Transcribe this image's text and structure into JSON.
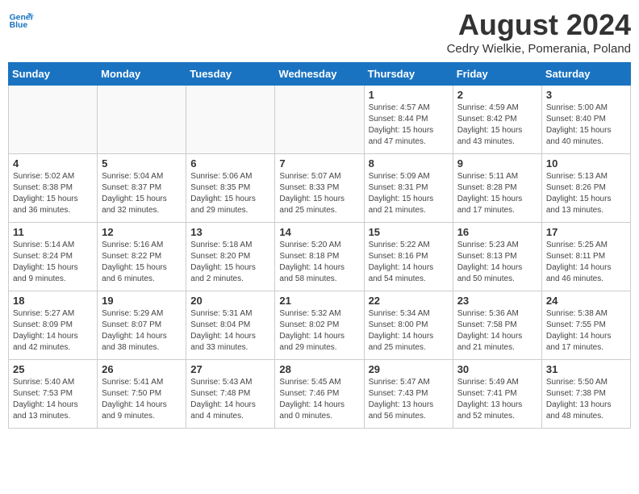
{
  "header": {
    "logo_line1": "General",
    "logo_line2": "Blue",
    "month_title": "August 2024",
    "location": "Cedry Wielkie, Pomerania, Poland"
  },
  "weekdays": [
    "Sunday",
    "Monday",
    "Tuesday",
    "Wednesday",
    "Thursday",
    "Friday",
    "Saturday"
  ],
  "weeks": [
    [
      {
        "day": "",
        "info": ""
      },
      {
        "day": "",
        "info": ""
      },
      {
        "day": "",
        "info": ""
      },
      {
        "day": "",
        "info": ""
      },
      {
        "day": "1",
        "info": "Sunrise: 4:57 AM\nSunset: 8:44 PM\nDaylight: 15 hours and 47 minutes."
      },
      {
        "day": "2",
        "info": "Sunrise: 4:59 AM\nSunset: 8:42 PM\nDaylight: 15 hours and 43 minutes."
      },
      {
        "day": "3",
        "info": "Sunrise: 5:00 AM\nSunset: 8:40 PM\nDaylight: 15 hours and 40 minutes."
      }
    ],
    [
      {
        "day": "4",
        "info": "Sunrise: 5:02 AM\nSunset: 8:38 PM\nDaylight: 15 hours and 36 minutes."
      },
      {
        "day": "5",
        "info": "Sunrise: 5:04 AM\nSunset: 8:37 PM\nDaylight: 15 hours and 32 minutes."
      },
      {
        "day": "6",
        "info": "Sunrise: 5:06 AM\nSunset: 8:35 PM\nDaylight: 15 hours and 29 minutes."
      },
      {
        "day": "7",
        "info": "Sunrise: 5:07 AM\nSunset: 8:33 PM\nDaylight: 15 hours and 25 minutes."
      },
      {
        "day": "8",
        "info": "Sunrise: 5:09 AM\nSunset: 8:31 PM\nDaylight: 15 hours and 21 minutes."
      },
      {
        "day": "9",
        "info": "Sunrise: 5:11 AM\nSunset: 8:28 PM\nDaylight: 15 hours and 17 minutes."
      },
      {
        "day": "10",
        "info": "Sunrise: 5:13 AM\nSunset: 8:26 PM\nDaylight: 15 hours and 13 minutes."
      }
    ],
    [
      {
        "day": "11",
        "info": "Sunrise: 5:14 AM\nSunset: 8:24 PM\nDaylight: 15 hours and 9 minutes."
      },
      {
        "day": "12",
        "info": "Sunrise: 5:16 AM\nSunset: 8:22 PM\nDaylight: 15 hours and 6 minutes."
      },
      {
        "day": "13",
        "info": "Sunrise: 5:18 AM\nSunset: 8:20 PM\nDaylight: 15 hours and 2 minutes."
      },
      {
        "day": "14",
        "info": "Sunrise: 5:20 AM\nSunset: 8:18 PM\nDaylight: 14 hours and 58 minutes."
      },
      {
        "day": "15",
        "info": "Sunrise: 5:22 AM\nSunset: 8:16 PM\nDaylight: 14 hours and 54 minutes."
      },
      {
        "day": "16",
        "info": "Sunrise: 5:23 AM\nSunset: 8:13 PM\nDaylight: 14 hours and 50 minutes."
      },
      {
        "day": "17",
        "info": "Sunrise: 5:25 AM\nSunset: 8:11 PM\nDaylight: 14 hours and 46 minutes."
      }
    ],
    [
      {
        "day": "18",
        "info": "Sunrise: 5:27 AM\nSunset: 8:09 PM\nDaylight: 14 hours and 42 minutes."
      },
      {
        "day": "19",
        "info": "Sunrise: 5:29 AM\nSunset: 8:07 PM\nDaylight: 14 hours and 38 minutes."
      },
      {
        "day": "20",
        "info": "Sunrise: 5:31 AM\nSunset: 8:04 PM\nDaylight: 14 hours and 33 minutes."
      },
      {
        "day": "21",
        "info": "Sunrise: 5:32 AM\nSunset: 8:02 PM\nDaylight: 14 hours and 29 minutes."
      },
      {
        "day": "22",
        "info": "Sunrise: 5:34 AM\nSunset: 8:00 PM\nDaylight: 14 hours and 25 minutes."
      },
      {
        "day": "23",
        "info": "Sunrise: 5:36 AM\nSunset: 7:58 PM\nDaylight: 14 hours and 21 minutes."
      },
      {
        "day": "24",
        "info": "Sunrise: 5:38 AM\nSunset: 7:55 PM\nDaylight: 14 hours and 17 minutes."
      }
    ],
    [
      {
        "day": "25",
        "info": "Sunrise: 5:40 AM\nSunset: 7:53 PM\nDaylight: 14 hours and 13 minutes."
      },
      {
        "day": "26",
        "info": "Sunrise: 5:41 AM\nSunset: 7:50 PM\nDaylight: 14 hours and 9 minutes."
      },
      {
        "day": "27",
        "info": "Sunrise: 5:43 AM\nSunset: 7:48 PM\nDaylight: 14 hours and 4 minutes."
      },
      {
        "day": "28",
        "info": "Sunrise: 5:45 AM\nSunset: 7:46 PM\nDaylight: 14 hours and 0 minutes."
      },
      {
        "day": "29",
        "info": "Sunrise: 5:47 AM\nSunset: 7:43 PM\nDaylight: 13 hours and 56 minutes."
      },
      {
        "day": "30",
        "info": "Sunrise: 5:49 AM\nSunset: 7:41 PM\nDaylight: 13 hours and 52 minutes."
      },
      {
        "day": "31",
        "info": "Sunrise: 5:50 AM\nSunset: 7:38 PM\nDaylight: 13 hours and 48 minutes."
      }
    ]
  ]
}
